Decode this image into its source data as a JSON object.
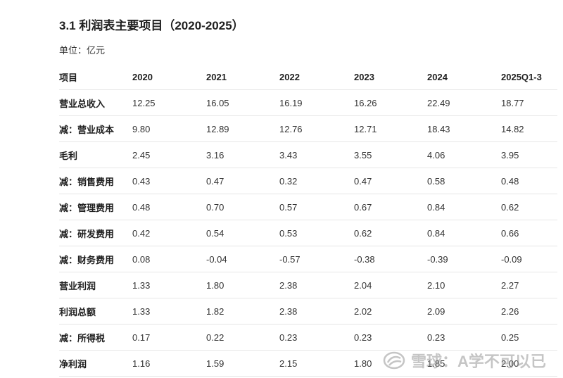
{
  "header": {
    "title": "3.1 利润表主要项目（2020-2025）",
    "unit": "单位：亿元"
  },
  "table": {
    "columns": [
      "项目",
      "2020",
      "2021",
      "2022",
      "2023",
      "2024",
      "2025Q1-3"
    ],
    "rows": [
      {
        "item": "营业总收入",
        "values": [
          "12.25",
          "16.05",
          "16.19",
          "16.26",
          "22.49",
          "18.77"
        ]
      },
      {
        "item": "减：营业成本",
        "values": [
          "9.80",
          "12.89",
          "12.76",
          "12.71",
          "18.43",
          "14.82"
        ]
      },
      {
        "item": "毛利",
        "values": [
          "2.45",
          "3.16",
          "3.43",
          "3.55",
          "4.06",
          "3.95"
        ]
      },
      {
        "item": "减：销售费用",
        "values": [
          "0.43",
          "0.47",
          "0.32",
          "0.47",
          "0.58",
          "0.48"
        ]
      },
      {
        "item": "减：管理费用",
        "values": [
          "0.48",
          "0.70",
          "0.57",
          "0.67",
          "0.84",
          "0.62"
        ]
      },
      {
        "item": "减：研发费用",
        "values": [
          "0.42",
          "0.54",
          "0.53",
          "0.62",
          "0.84",
          "0.66"
        ]
      },
      {
        "item": "减：财务费用",
        "values": [
          "0.08",
          "-0.04",
          "-0.57",
          "-0.38",
          "-0.39",
          "-0.09"
        ]
      },
      {
        "item": "营业利润",
        "values": [
          "1.33",
          "1.80",
          "2.38",
          "2.04",
          "2.10",
          "2.27"
        ]
      },
      {
        "item": "利润总额",
        "values": [
          "1.33",
          "1.82",
          "2.38",
          "2.02",
          "2.09",
          "2.26"
        ]
      },
      {
        "item": "减：所得税",
        "values": [
          "0.17",
          "0.22",
          "0.23",
          "0.23",
          "0.23",
          "0.25"
        ]
      },
      {
        "item": "净利润",
        "values": [
          "1.16",
          "1.59",
          "2.15",
          "1.80",
          "1.85",
          "2.00"
        ]
      }
    ]
  },
  "watermark": {
    "icon": "snowball-logo-icon",
    "text": "雪球：A学不可以已"
  }
}
